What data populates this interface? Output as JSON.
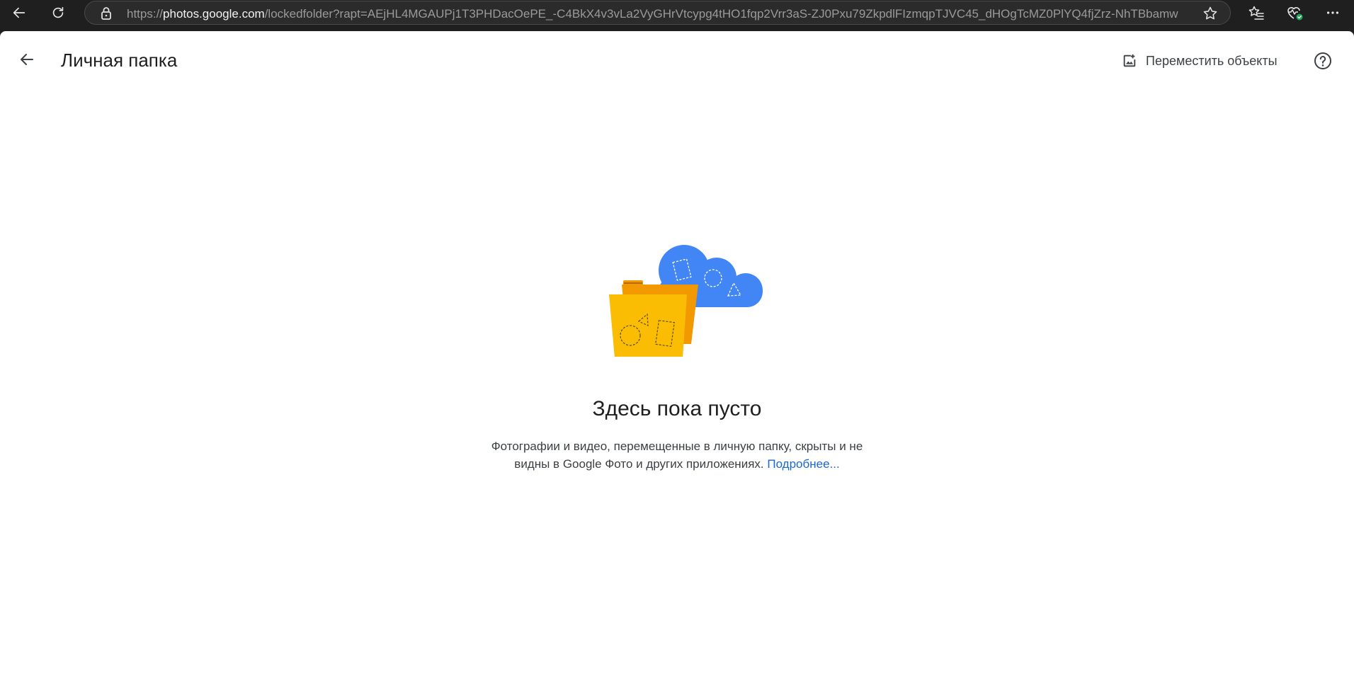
{
  "browser": {
    "url_scheme": "https://",
    "url_host": "photos.google.com",
    "url_path": "/lockedfolder?rapt=AEjHL4MGAUPj1T3PHDacOePE_-C4BkX4v3vLa2VyGHrVtcypg4tHO1fqp2Vrr3aS-ZJ0Pxu79ZkpdlFIzmqpTJVC45_dHOgTcMZ0PlYQ4fjZrz-NhTBbamw"
  },
  "header": {
    "title": "Личная папка",
    "move_label": "Переместить объекты"
  },
  "empty_state": {
    "title": "Здесь пока пусто",
    "description_line1": "Фотографии и видео, перемещенные в личную папку, скрыты и не",
    "description_line2": "видны в Google Фото и других приложениях. ",
    "learn_more": "Подробнее..."
  },
  "colors": {
    "cloud": "#4285f4",
    "folder_front": "#fbbc04",
    "folder_back": "#f29900",
    "link": "#1a67d2"
  }
}
